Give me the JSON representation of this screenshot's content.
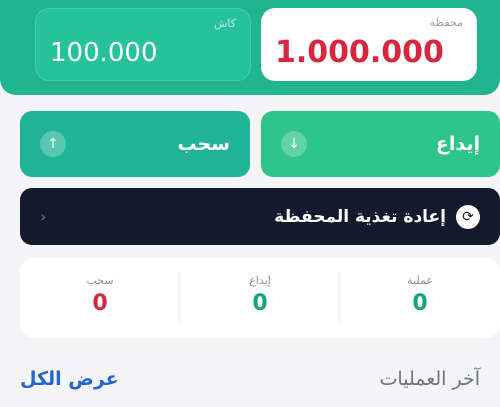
{
  "wallet": {
    "label": "محفظة",
    "value": "1.000.000"
  },
  "cash": {
    "label": "كاش",
    "value": "100.000"
  },
  "actions": {
    "deposit_label": "إيداع",
    "deposit_icon": "arrow-down-icon",
    "withdraw_label": "سحب",
    "withdraw_icon": "arrow-up-icon"
  },
  "refill": {
    "label": "إعادة تغذية المحفظة",
    "icon": "refresh-icon",
    "chevron": "chevron-left-icon"
  },
  "stats": [
    {
      "label": "عملية",
      "value": "0",
      "color": "#16a37a"
    },
    {
      "label": "إيداع",
      "value": "0",
      "color": "#16a37a"
    },
    {
      "label": "سحب",
      "value": "0",
      "color": "#d7263d"
    }
  ],
  "recent": {
    "title": "آخر العمليات",
    "view_all": "عرض الكل"
  },
  "colors": {
    "accent": "#20b58f",
    "dark": "#141a2e",
    "red": "#d7263d",
    "link": "#2366d1"
  }
}
